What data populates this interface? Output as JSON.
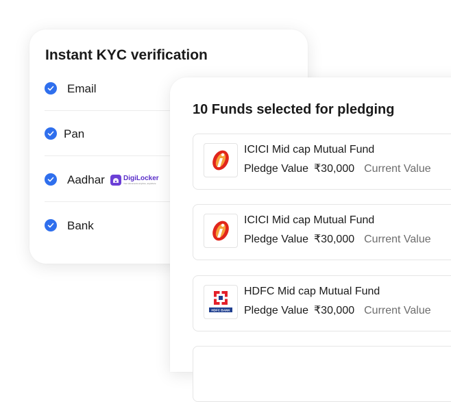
{
  "kyc": {
    "title": "Instant KYC verification",
    "items": [
      {
        "label": "Email"
      },
      {
        "label": "Pan"
      },
      {
        "label": "Aadhar",
        "badge": "DigiLocker",
        "badge_sub": "Your documents anytime, anywhere"
      },
      {
        "label": "Bank"
      }
    ],
    "check_color": "#2f6fed"
  },
  "funds": {
    "title": "10 Funds selected for pledging",
    "items": [
      {
        "name": "ICICI Mid cap Mutual Fund",
        "pledge_label": "Pledge Value",
        "pledge_value": "₹30,000",
        "current_label": "Current Value",
        "logo": "icici-logo"
      },
      {
        "name": "ICICI Mid cap Mutual Fund",
        "pledge_label": "Pledge Value",
        "pledge_value": "₹30,000",
        "current_label": "Current Value",
        "logo": "icici-logo"
      },
      {
        "name": "HDFC Mid cap Mutual Fund",
        "pledge_label": "Pledge Value",
        "pledge_value": "₹30,000",
        "current_label": "Current Value",
        "logo": "hdfc-logo",
        "logo_text": "HDFC BANK"
      }
    ]
  }
}
